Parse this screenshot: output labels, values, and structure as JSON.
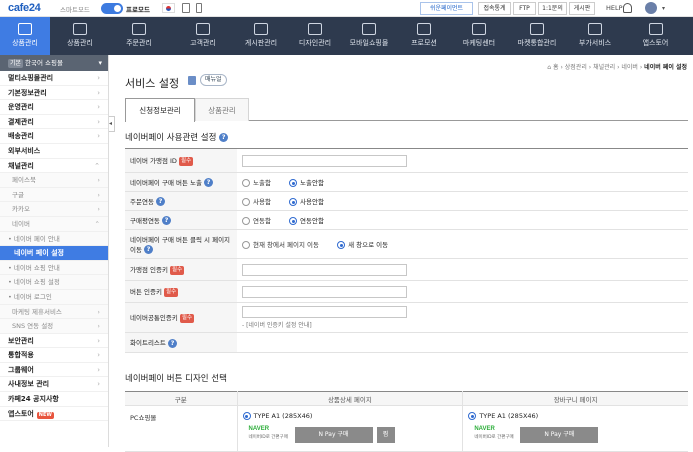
{
  "topbar": {
    "logo": "cafe24",
    "smart_mode_label": "스마트모드",
    "pro_mode_label": "프로모드",
    "buttons": [
      "쉬운페이먼트",
      "접속통계",
      "FTP",
      "1:1문의",
      "게시판"
    ],
    "help_label": "HELP"
  },
  "nav": {
    "items": [
      {
        "label": "상품관리",
        "active": true
      },
      {
        "label": "상품관리",
        "active": false
      },
      {
        "label": "주문관리",
        "active": false
      },
      {
        "label": "고객관리",
        "active": false
      },
      {
        "label": "게시판관리",
        "active": false
      },
      {
        "label": "디자인관리",
        "active": false
      },
      {
        "label": "모바일쇼핑몰",
        "active": false
      },
      {
        "label": "프로모션",
        "active": false
      },
      {
        "label": "마케팅센터",
        "active": false
      },
      {
        "label": "마켓통합관리",
        "active": false
      },
      {
        "label": "부가서비스",
        "active": false
      },
      {
        "label": "앱스토어",
        "active": false
      }
    ]
  },
  "sidebar": {
    "shop_badge": "기본",
    "shop_name": "한국어 쇼핑몰",
    "items": [
      {
        "label": "멀티쇼핑몰관리",
        "kind": "main",
        "chev": "›"
      },
      {
        "label": "기본정보관리",
        "kind": "main",
        "chev": "›"
      },
      {
        "label": "운영관리",
        "kind": "main",
        "chev": "›"
      },
      {
        "label": "결제관리",
        "kind": "main",
        "chev": "›"
      },
      {
        "label": "배송관리",
        "kind": "main",
        "chev": "›"
      },
      {
        "label": "외부서비스",
        "kind": "main",
        "chev": ""
      },
      {
        "label": "채널관리",
        "kind": "main",
        "chev": "⌃"
      },
      {
        "label": "페이스북",
        "kind": "sub",
        "chev": "›"
      },
      {
        "label": "구글",
        "kind": "sub",
        "chev": "›"
      },
      {
        "label": "카카오",
        "kind": "sub",
        "chev": "›"
      },
      {
        "label": "네이버",
        "kind": "sub",
        "chev": "⌃"
      },
      {
        "label": "• 네이버 페이 안내",
        "kind": "subsub",
        "chev": ""
      },
      {
        "label": "네이버 페이 설정",
        "kind": "current",
        "chev": ""
      },
      {
        "label": "• 네이버 쇼핑 안내",
        "kind": "subsub",
        "chev": ""
      },
      {
        "label": "• 네이버 쇼핑 설정",
        "kind": "subsub",
        "chev": ""
      },
      {
        "label": "• 네이버 로그인",
        "kind": "subsub",
        "chev": ""
      },
      {
        "label": "마케팅 제휴서비스",
        "kind": "sub",
        "chev": "›"
      },
      {
        "label": "SNS 연동 설정",
        "kind": "sub",
        "chev": "›"
      },
      {
        "label": "보안관리",
        "kind": "main",
        "chev": "›"
      },
      {
        "label": "통합적용",
        "kind": "main",
        "chev": "›"
      },
      {
        "label": "그룹웨어",
        "kind": "main",
        "chev": "›"
      },
      {
        "label": "사내정보 관리",
        "kind": "main",
        "chev": "›"
      },
      {
        "label": "카페24 공지사항",
        "kind": "main",
        "chev": ""
      },
      {
        "label": "앱스토어",
        "kind": "main",
        "chev": "",
        "badge": "NEW"
      }
    ]
  },
  "content": {
    "breadcrumb": [
      "홈",
      "상점관리",
      "채널관리",
      "네이버"
    ],
    "breadcrumb_current": "네이버 페이 설정",
    "page_title": "서비스 설정",
    "manual_label": "매뉴얼",
    "tabs": [
      {
        "label": "신청정보관리",
        "active": true
      },
      {
        "label": "상품관리",
        "active": false
      }
    ],
    "section1_title": "네이버페이 사용관련 설정",
    "form": {
      "merchant_id": {
        "label": "네이버 가맹점 ID",
        "required": "필수"
      },
      "exposure": {
        "label": "네이버페이 구매 버튼 노출",
        "options": [
          "노출함",
          "노출안함"
        ],
        "selected": 1
      },
      "order_link": {
        "label": "주문연동",
        "options": [
          "사용함",
          "사용안함"
        ],
        "selected": 1
      },
      "purchase_link": {
        "label": "구매평연동",
        "options": [
          "연동함",
          "연동안함"
        ],
        "selected": 1
      },
      "click_action": {
        "label": "네이버페이 구매 버튼 클릭 시 페이지 이동",
        "options": [
          "현재 창에서 페이지 이동",
          "새 창으로 이동"
        ],
        "selected": 1
      },
      "auth_key": {
        "label": "가맹점 인증키",
        "required": "필수"
      },
      "button_key": {
        "label": "버튼 인증키",
        "required": "필수"
      },
      "common_key": {
        "label": "네이버공통인증키",
        "required": "필수",
        "note": "- [네이버 인증키 설정 안내]"
      },
      "whitelist": {
        "label": "화이트리스트"
      }
    },
    "section2_title": "네이버페이 버튼 디자인 선택",
    "design_table": {
      "headers": [
        "구분",
        "상품상세 페이지",
        "장바구니 페이지"
      ],
      "row_label": "PC쇼핑몰",
      "type_label": "TYPE A1 (285X46)",
      "naver_label": "NAVER",
      "naver_sub": "네이버ID로 간편구매",
      "pay_label": "N Pay 구매",
      "wish_label": "찜"
    }
  }
}
